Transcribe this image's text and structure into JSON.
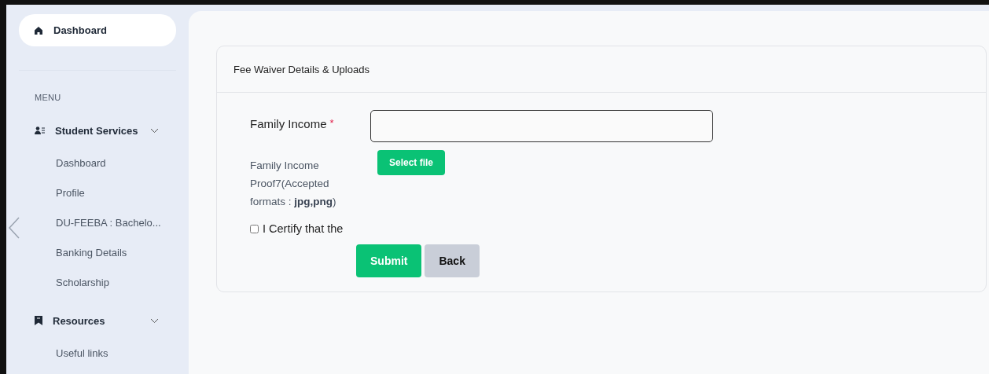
{
  "sidebar": {
    "home": {
      "label": "Dashboard",
      "selected": true
    },
    "section_label": "MENU",
    "groups": [
      {
        "label": "Student Services",
        "kind": "services",
        "expanded": true,
        "items": [
          {
            "label": "Dashboard"
          },
          {
            "label": "Profile"
          },
          {
            "label": "DU-FEEBA : Bachelo..."
          },
          {
            "label": "Banking Details"
          },
          {
            "label": "Scholarship"
          }
        ]
      },
      {
        "label": "Resources",
        "kind": "resources",
        "expanded": true,
        "items": [
          {
            "label": "Useful links"
          }
        ]
      }
    ]
  },
  "card": {
    "title": "Fee Waiver Details & Uploads",
    "income_label": "Family Income",
    "required_mark": "*",
    "proof_label": "Family Income Proof7(Accepted formats : **jpg,png**)",
    "select_file": "Select file",
    "certify": {
      "label": "I Certify that the",
      "checked": false
    },
    "buttons": [
      {
        "label": "Submit",
        "kind": "primary"
      },
      {
        "label": "Back",
        "kind": "secondary"
      }
    ]
  }
}
